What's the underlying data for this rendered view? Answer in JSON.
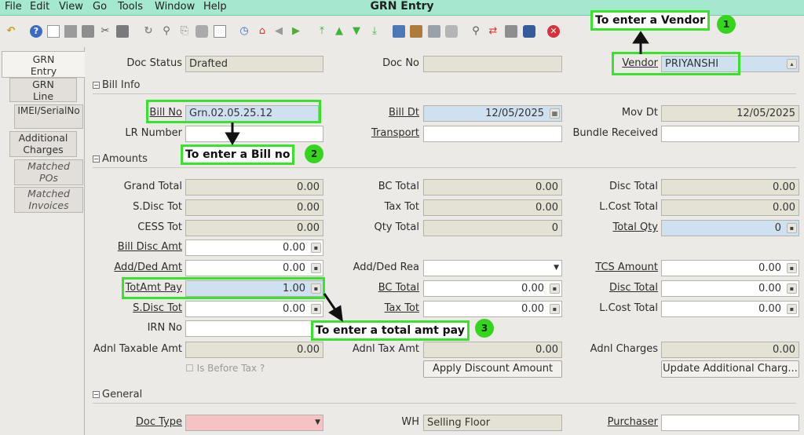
{
  "menu": [
    "File",
    "Edit",
    "View",
    "Go",
    "Tools",
    "Window",
    "Help"
  ],
  "window_title": "GRN Entry",
  "toolbar_icons": [
    "undo-icon",
    "help-icon",
    "new-icon",
    "copy-icon",
    "delete-icon",
    "delete-selection-icon",
    "save-icon",
    "refresh-icon",
    "find-icon",
    "attachment-icon",
    "chat-icon",
    "grid-toggle-icon",
    "history-icon",
    "home-icon",
    "previous-record-icon",
    "next-record-icon",
    "first-record-icon",
    "parent-record-icon",
    "child-record-icon",
    "last-record-icon",
    "report-icon",
    "archive-icon",
    "print-preview-icon",
    "print-icon",
    "zoom-across-icon",
    "workflow-icon",
    "product-info-icon",
    "process-icon",
    "close-window-icon"
  ],
  "tabs": [
    {
      "label": "GRN\nEntry"
    },
    {
      "label": "GRN\nLine"
    },
    {
      "label": "IMEI/SerialNo"
    },
    {
      "label": "Additional\nCharges"
    },
    {
      "label": "Matched\nPOs"
    },
    {
      "label": "Matched\nInvoices"
    }
  ],
  "header": {
    "doc_status_label": "Doc Status",
    "doc_status": "Drafted",
    "doc_no_label": "Doc No",
    "doc_no": "",
    "vendor_label": "Vendor",
    "vendor": "PRIYANSHI"
  },
  "bill_info": {
    "title": "Bill Info",
    "bill_no_label": "Bill No",
    "bill_no": "Grn.02.05.25.12",
    "bill_dt_label": "Bill Dt",
    "bill_dt": "12/05/2025",
    "mov_dt_label": "Mov Dt",
    "mov_dt": "12/05/2025",
    "lr_number_label": "LR Number",
    "lr_number": "",
    "transport_label": "Transport",
    "transport": "",
    "bundle_label": "Bundle Received",
    "bundle": ""
  },
  "amounts": {
    "title": "Amounts",
    "grand_total_label": "Grand Total",
    "grand_total": "0.00",
    "bc_total_label": "BC Total",
    "bc_total": "0.00",
    "disc_total_label": "Disc Total",
    "disc_total": "0.00",
    "sdisc_tot_label": "S.Disc Tot",
    "sdisc_tot": "0.00",
    "tax_tot_label": "Tax Tot",
    "tax_tot": "0.00",
    "lcost_total_label": "L.Cost Total",
    "lcost_total": "0.00",
    "cess_tot_label": "CESS Tot",
    "cess_tot": "0.00",
    "qty_total_label": "Qty Total",
    "qty_total": "0",
    "total_qty_label": "Total Qty",
    "total_qty": "0",
    "bill_disc_amt_label": "Bill Disc Amt",
    "bill_disc_amt": "0.00",
    "add_ded_amt_label": "Add/Ded Amt",
    "add_ded_amt": "0.00",
    "add_ded_rea_label": "Add/Ded Rea",
    "add_ded_rea": "",
    "tcs_amount_label": "TCS Amount",
    "tcs_amount": "0.00",
    "totamt_pay_label": "TotAmt Pay",
    "totamt_pay": "1.00",
    "bc_total2_label": "BC Total",
    "bc_total2": "0.00",
    "disc_total2_label": "Disc Total",
    "disc_total2": "0.00",
    "sdisc_tot2_label": "S.Disc Tot",
    "sdisc_tot2": "0.00",
    "tax_tot2_label": "Tax Tot",
    "tax_tot2": "0.00",
    "lcost_total2_label": "L.Cost Total",
    "lcost_total2": "0.00",
    "irn_no_label": "IRN No",
    "irn_no": "",
    "adnl_taxable_label": "Adnl Taxable Amt",
    "adnl_taxable": "0.00",
    "adnl_tax_label": "Adnl Tax Amt",
    "adnl_tax": "0.00",
    "adnl_charges_label": "Adnl Charges",
    "adnl_charges": "0.00",
    "is_before_tax_label": "Is Before Tax ?",
    "apply_discount_button": "Apply Discount Amount",
    "update_additional_button": "Update Additional Charg..."
  },
  "general": {
    "title": "General",
    "doc_type_label": "Doc Type",
    "doc_type": "",
    "wh_label": "WH",
    "wh": "Selling Floor",
    "purchaser_label": "Purchaser",
    "purchaser": ""
  },
  "annotations": {
    "vendor_note": "To enter a Vendor",
    "vendor_step": "1",
    "bill_note": "To enter a Bill no",
    "bill_step": "2",
    "amt_note": "To enter a total amt pay",
    "amt_step": "3",
    "highlight_color": "#39e32c"
  }
}
